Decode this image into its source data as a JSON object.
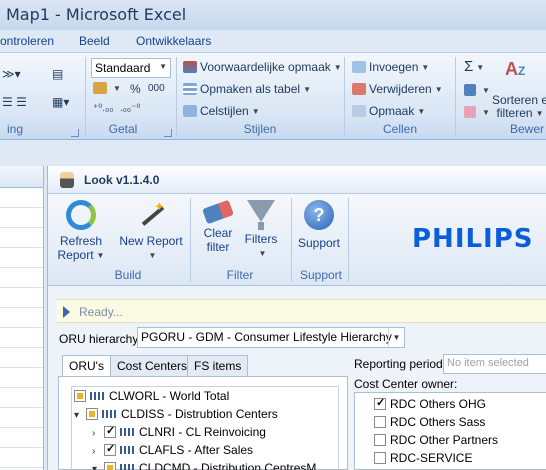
{
  "window": {
    "title": "Map1  -  Microsoft Excel"
  },
  "ribbon_tabs": [
    "ontroleren",
    "Beeld",
    "Ontwikkelaars"
  ],
  "ribbon": {
    "number_format": "Standaard",
    "currency_symbols": [
      "%",
      "000"
    ],
    "styles": {
      "conditional": "Voorwaardelijke opmaak",
      "as_table": "Opmaken als tabel",
      "cell_styles": "Celstijlen"
    },
    "cells": {
      "insert": "Invoegen",
      "delete": "Verwijderen",
      "format": "Opmaak"
    },
    "editing": {
      "sum": "Σ",
      "sort_line1": "Sorteren e",
      "sort_line2": "filteren"
    },
    "group_labels": {
      "alignment": "ing",
      "number": "Getal",
      "styles": "Stijlen",
      "cells": "Cellen",
      "editing": "Bewer"
    }
  },
  "pane": {
    "title": "Look v1.1.4.0",
    "buttons": {
      "refresh_line1": "Refresh",
      "refresh_line2": "Report",
      "new_report": "New Report",
      "clear_line1": "Clear",
      "clear_line2": "filter",
      "filters": "Filters",
      "support": "Support"
    },
    "group_labels": {
      "build": "Build",
      "filter": "Filter",
      "support": "Support"
    },
    "brand": "PHILIPS",
    "status": "Ready...",
    "hierarchy_label": "ORU hierarchy:",
    "hierarchy_value": "PGORU - GDM - Consumer Lifestyle Hierarchy",
    "tabs": [
      "ORU's",
      "Cost Centers",
      "FS items"
    ],
    "tree": [
      {
        "label": "CLWORL - World Total"
      },
      {
        "label": "CLDISS - Distrubtion Centers"
      },
      {
        "label": "CLNRI - CL Reinvoicing"
      },
      {
        "label": "CLAFLS - After Sales"
      },
      {
        "label": "CLDCMD - Distribution CentresM"
      }
    ],
    "reporting_period_label": "Reporting period:",
    "reporting_period_placeholder": "No item selected",
    "cost_center_owner_label": "Cost Center owner:",
    "owners": [
      {
        "label": "RDC Others OHG",
        "checked": true
      },
      {
        "label": "RDC Others Sass",
        "checked": false
      },
      {
        "label": "RDC Other Partners",
        "checked": false
      },
      {
        "label": "RDC-SERVICE",
        "checked": false
      }
    ]
  }
}
